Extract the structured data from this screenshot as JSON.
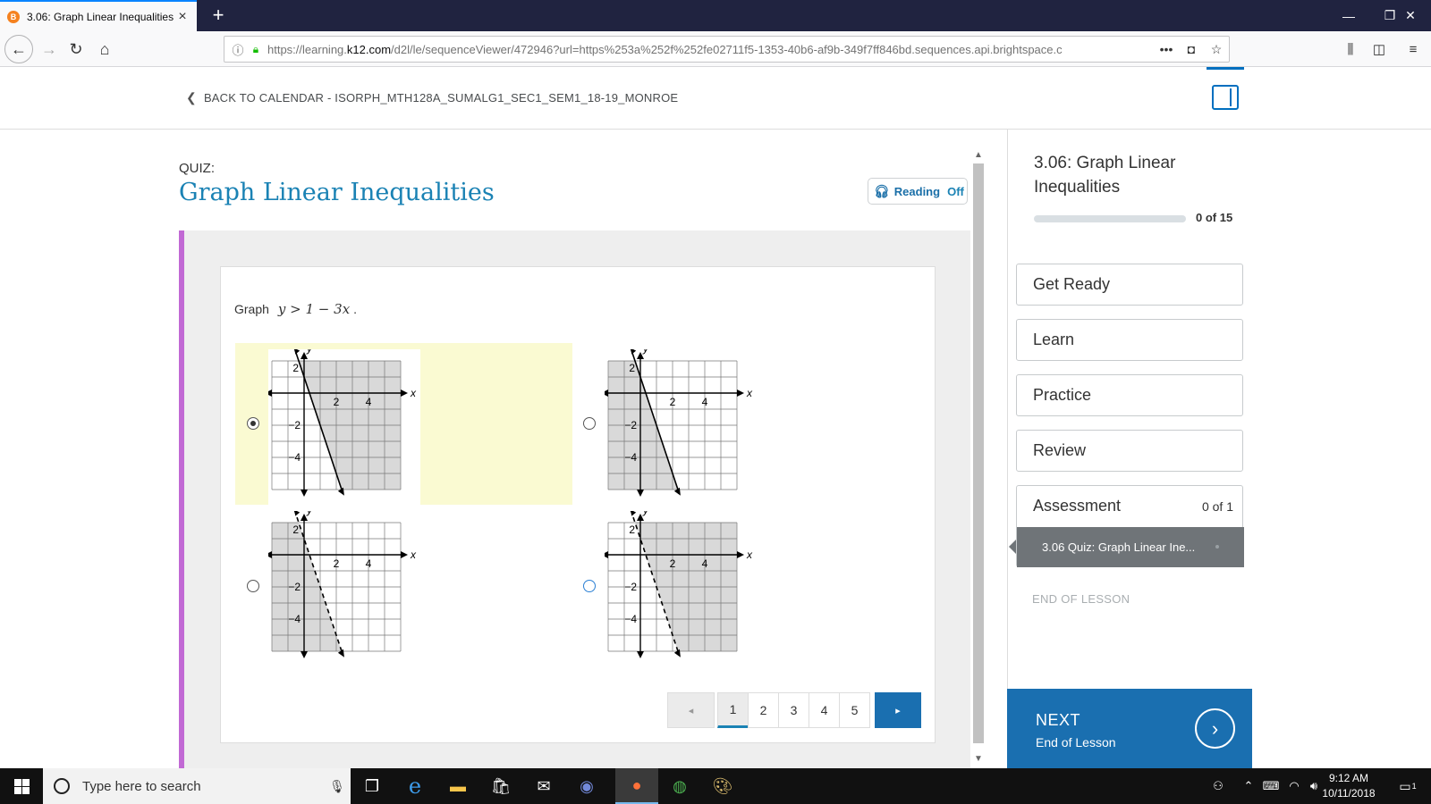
{
  "browser": {
    "tab_title": "3.06: Graph Linear Inequalities -",
    "tab_favicon_letter": "B",
    "url_prefix": "https://learning.",
    "url_domain": "k12.com",
    "url_rest": "/d2l/le/sequenceViewer/472946?url=https%253a%252f%252fe02711f5-1353-40b6-af9b-349f7ff846bd.sequences.api.brightspace.c",
    "icons": [
      "back-icon",
      "forward-icon",
      "reload-icon",
      "home-icon",
      "info-icon",
      "lock-icon",
      "more-icon",
      "pocket-icon",
      "bookmark-star-icon",
      "library-icon",
      "sidebar-icon",
      "menu-icon"
    ]
  },
  "header": {
    "back_link": "BACK TO CALENDAR - ISORPH_MTH128A_SUMALG1_SEC1_SEM1_18-19_MONROE"
  },
  "main": {
    "quiz_label": "QUIZ:",
    "title": "Graph Linear Inequalities",
    "reading_label": "Reading",
    "reading_state": "Off",
    "prompt_word": "Graph",
    "prompt_math": "y > 1 − 3x",
    "prompt_end": ".",
    "choices": [
      {
        "selected": true,
        "line": "solid",
        "shading": "right",
        "tick_pos_x": [
          "2",
          "4"
        ],
        "tick_neg_y": [
          "−2",
          "−4"
        ],
        "tick_pos_y": "2",
        "axis_x": "x",
        "axis_y": "y"
      },
      {
        "selected": false,
        "line": "solid",
        "shading": "left",
        "tick_pos_x": [
          "2",
          "4"
        ],
        "tick_neg_y": [
          "−2",
          "−4"
        ],
        "tick_pos_y": "2",
        "axis_x": "x",
        "axis_y": "y"
      },
      {
        "selected": false,
        "line": "dashed",
        "shading": "left",
        "tick_pos_x": [
          "2",
          "4"
        ],
        "tick_neg_y": [
          "−2",
          "−4"
        ],
        "tick_pos_y": "2",
        "axis_x": "x",
        "axis_y": "y"
      },
      {
        "selected": false,
        "line": "dashed",
        "shading": "right",
        "tick_pos_x": [
          "2",
          "4"
        ],
        "tick_neg_y": [
          "−2",
          "−4"
        ],
        "tick_pos_y": "2",
        "axis_x": "x",
        "axis_y": "y"
      }
    ],
    "pagination": {
      "prev": "◂",
      "next": "▸",
      "pages": [
        "1",
        "2",
        "3",
        "4",
        "5"
      ],
      "active_page": "1"
    }
  },
  "sidebar": {
    "title": "3.06: Graph Linear Inequalities",
    "progress_text": "0 of 15",
    "progress_fraction": 0,
    "items": [
      "Get Ready",
      "Learn",
      "Practice",
      "Review"
    ],
    "assessment_label": "Assessment",
    "assessment_count": "0 of 1",
    "assessment_sub": "3.06 Quiz: Graph Linear Ine...",
    "end_of_lesson": "END OF LESSON",
    "next_label": "NEXT",
    "next_sub": "End of Lesson"
  },
  "taskbar": {
    "search_placeholder": "Type here to search",
    "time": "9:12 AM",
    "date": "10/11/2018",
    "notification_count": "1",
    "apps": [
      "task-view-icon",
      "edge-icon",
      "file-explorer-icon",
      "store-icon",
      "mail-icon",
      "discord-icon",
      "firefox-icon",
      "chrome-icon",
      "paint-icon"
    ]
  },
  "colors": {
    "accent": "#1a82b4",
    "next_button": "#1a6fb0",
    "selected_highlight": "#fafad2",
    "quiz_bar": "#c169d4",
    "grid_shade": "#d9d9d9"
  }
}
